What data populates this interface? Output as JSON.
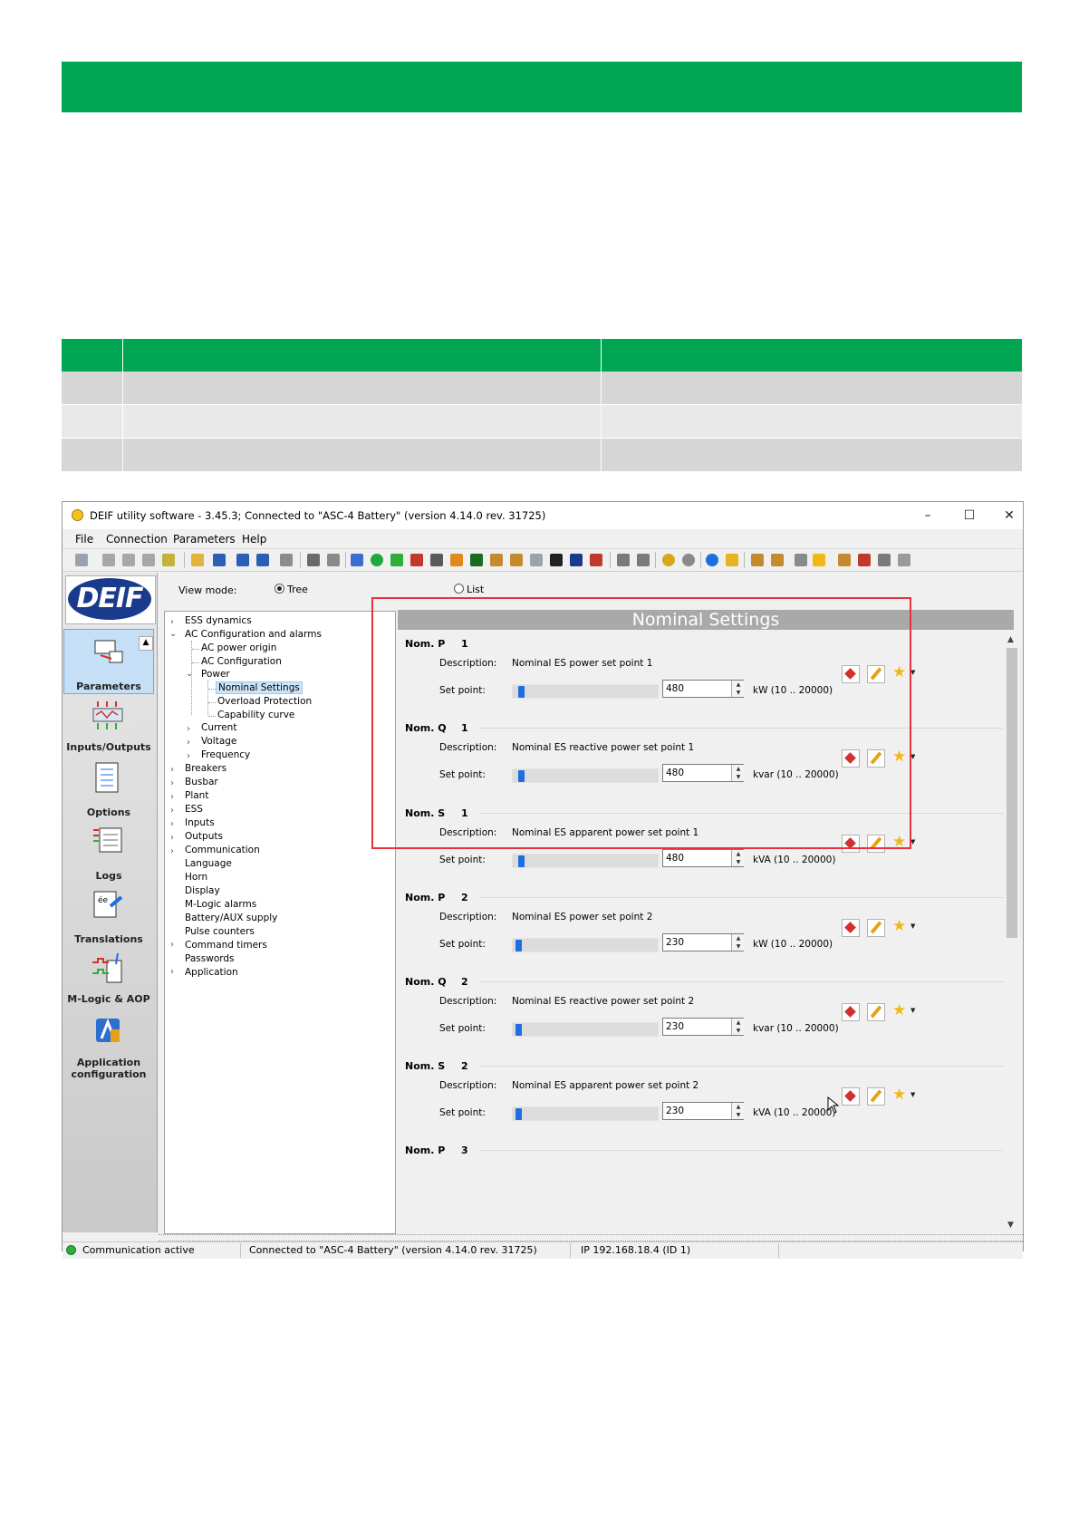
{
  "window": {
    "title": "DEIF utility software - 3.45.3; Connected to \"ASC-4 Battery\" (version 4.14.0 rev. 31725)",
    "controls": {
      "minimize": "–",
      "maximize": "☐",
      "close": "✕"
    }
  },
  "menu": [
    "File",
    "Connection",
    "Parameters",
    "Help"
  ],
  "sidebar": {
    "logo": "DEIF",
    "items": [
      {
        "label": "Parameters",
        "icon": "parameters-icon",
        "active": true
      },
      {
        "label": "Inputs/Outputs",
        "icon": "inputs-outputs-icon"
      },
      {
        "label": "Options",
        "icon": "options-icon"
      },
      {
        "label": "Logs",
        "icon": "logs-icon"
      },
      {
        "label": "Translations",
        "icon": "translations-icon"
      },
      {
        "label": "M-Logic & AOP",
        "icon": "mlogic-icon"
      },
      {
        "label": "Application configuration",
        "icon": "application-icon"
      }
    ]
  },
  "view_mode": {
    "label": "View mode:",
    "options": [
      "Tree",
      "List"
    ],
    "selected": "Tree"
  },
  "tree": [
    "ESS dynamics",
    "AC Configuration and alarms",
    "AC power origin",
    "AC Configuration",
    "Power",
    "Nominal Settings",
    "Overload Protection",
    "Capability curve",
    "Current",
    "Voltage",
    "Frequency",
    "Breakers",
    "Busbar",
    "Plant",
    "ESS",
    "Inputs",
    "Outputs",
    "Communication",
    "Language",
    "Horn",
    "Display",
    "M-Logic alarms",
    "Battery/AUX supply",
    "Pulse counters",
    "Command timers",
    "Passwords",
    "Application"
  ],
  "panel": {
    "title": "Nominal Settings",
    "description_label": "Description:",
    "setpoint_label": "Set point:",
    "params": [
      {
        "name": "Nom. P",
        "index": "1",
        "description": "Nominal ES power set point 1",
        "value": "480",
        "unit": "kW (10 .. 20000)"
      },
      {
        "name": "Nom. Q",
        "index": "1",
        "description": "Nominal ES reactive power set point 1",
        "value": "480",
        "unit": "kvar (10 .. 20000)"
      },
      {
        "name": "Nom. S",
        "index": "1",
        "description": "Nominal ES apparent power set point 1",
        "value": "480",
        "unit": "kVA (10 .. 20000)"
      },
      {
        "name": "Nom. P",
        "index": "2",
        "description": "Nominal ES power set point 2",
        "value": "230",
        "unit": "kW (10 .. 20000)"
      },
      {
        "name": "Nom. Q",
        "index": "2",
        "description": "Nominal ES reactive power set point 2",
        "value": "230",
        "unit": "kvar (10 .. 20000)"
      },
      {
        "name": "Nom. S",
        "index": "2",
        "description": "Nominal ES apparent power set point 2",
        "value": "230",
        "unit": "kVA (10 .. 20000)"
      },
      {
        "name": "Nom. P",
        "index": "3"
      }
    ]
  },
  "status": {
    "communication": "Communication active",
    "connection": "Connected to \"ASC-4 Battery\" (version 4.14.0 rev. 31725)",
    "ip": "IP 192.168.18.4 (ID 1)"
  },
  "colors": {
    "brand_green": "#00a651",
    "highlight_red": "#e6323c",
    "selection_blue": "#cce4f7"
  }
}
